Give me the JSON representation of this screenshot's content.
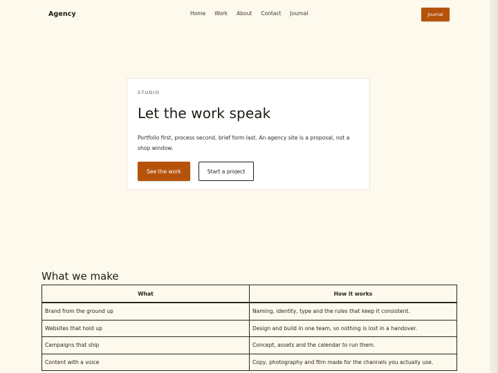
{
  "header": {
    "brand": "Agency",
    "nav": [
      {
        "label": "Home"
      },
      {
        "label": "Work"
      },
      {
        "label": "About"
      },
      {
        "label": "Contact"
      },
      {
        "label": "Journal"
      }
    ],
    "cta_label": "Journal"
  },
  "hero": {
    "eyebrow": "STUDIO",
    "title": "Let the work speak",
    "body": "Portfolio first, process second, brief form last. An agency site is a proposal, not a shop window.",
    "primary_label": "See the work",
    "secondary_label": "Start a project"
  },
  "section": {
    "title": "What we make",
    "columns": [
      "What",
      "How it works"
    ],
    "rows": [
      [
        "Brand from the ground up",
        "Naming, identity, type and the rules that keep it consistent."
      ],
      [
        "Websites that hold up",
        "Design and build in one team, so nothing is lost in a handover."
      ],
      [
        "Campaigns that ship",
        "Concept, assets and the calendar to run them."
      ],
      [
        "Content with a voice",
        "Copy, photography and film made for the channels you actually use."
      ]
    ]
  },
  "colors": {
    "page_background": "#fdf9ed",
    "accent": "#b6530b",
    "card_background": "#ffffff",
    "text": "#1f1a14"
  }
}
